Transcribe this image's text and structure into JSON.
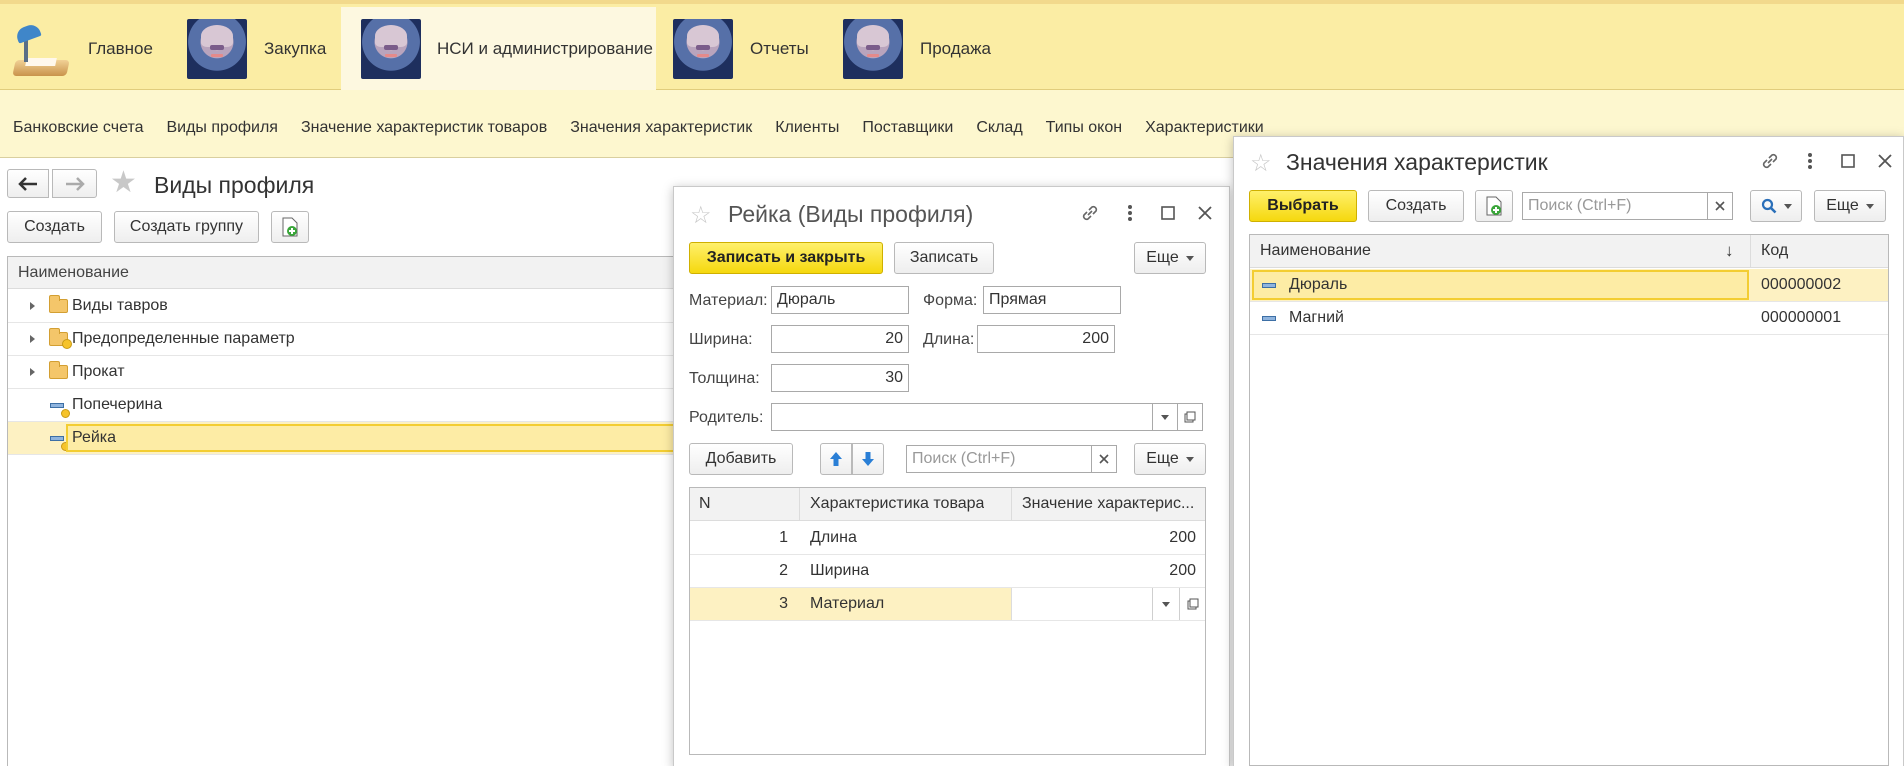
{
  "sections": {
    "main": "Главное",
    "purchase": "Закупка",
    "nsi": "НСИ и администрирование",
    "reports": "Отчеты",
    "sales": "Продажа"
  },
  "subnav": [
    "Банковские счета",
    "Виды профиля",
    "Значение характеристик товаров",
    "Значения характеристик",
    "Клиенты",
    "Поставщики",
    "Склад",
    "Типы окон",
    "Характеристики"
  ],
  "main_form": {
    "title": "Виды профиля",
    "create": "Создать",
    "create_group": "Создать группу",
    "column_name": "Наименование",
    "rows": [
      "Виды тавров",
      "Предопределенные параметр",
      "Прокат",
      "Попечерина",
      "Рейка"
    ]
  },
  "item_form": {
    "title": "Рейка (Виды профиля)",
    "save_close": "Записать и закрыть",
    "save": "Записать",
    "more": "Еще",
    "material_label": "Материал:",
    "material_value": "Дюраль",
    "shape_label": "Форма:",
    "shape_value": "Прямая",
    "width_label": "Ширина:",
    "width_value": "20",
    "length_label": "Длина:",
    "length_value": "200",
    "thickness_label": "Толщина:",
    "thickness_value": "30",
    "parent_label": "Родитель:",
    "parent_value": "",
    "add": "Добавить",
    "search_placeholder": "Поиск (Ctrl+F)",
    "columns": {
      "n": "N",
      "characteristic": "Характеристика товара",
      "value": "Значение характерис..."
    },
    "rows": [
      {
        "n": "1",
        "characteristic": "Длина",
        "value": "200"
      },
      {
        "n": "2",
        "characteristic": "Ширина",
        "value": "200"
      },
      {
        "n": "3",
        "characteristic": "Материал",
        "value": ""
      }
    ]
  },
  "values_form": {
    "title": "Значения характеристик",
    "select": "Выбрать",
    "create": "Создать",
    "search_placeholder": "Поиск (Ctrl+F)",
    "more": "Еще",
    "columns": {
      "name": "Наименование",
      "code": "Код"
    },
    "rows": [
      {
        "name": "Дюраль",
        "code": "000000002"
      },
      {
        "name": "Магний",
        "code": "000000001"
      }
    ]
  }
}
